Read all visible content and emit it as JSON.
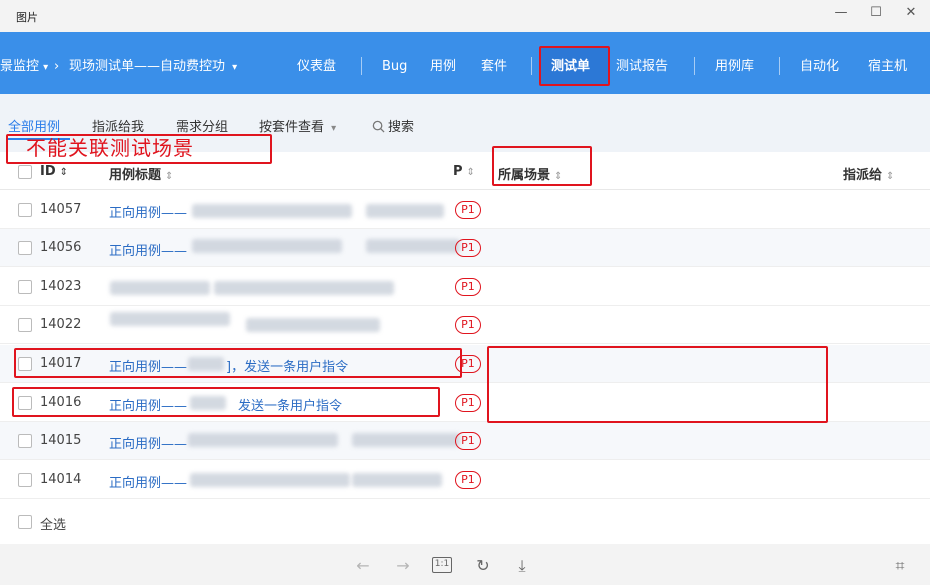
{
  "window": {
    "title": "图片",
    "minimize": "—",
    "maximize": "☐",
    "close": "✕"
  },
  "nav": {
    "project": "景监控",
    "project_caret": "▾",
    "breadcrumb_sep": "›",
    "testplan": "现场测试单——自动费控功",
    "testplan_caret": "▾",
    "items": [
      "仪表盘",
      "Bug",
      "用例",
      "套件",
      "测试单",
      "测试报告",
      "用例库",
      "自动化",
      "宿主机"
    ]
  },
  "toolbar": {
    "tabs": [
      "全部用例",
      "指派给我",
      "需求分组",
      "按套件查看"
    ],
    "suite_caret": "▾",
    "search_label": "搜索"
  },
  "annotation": {
    "text": "不能关联测试场景"
  },
  "table": {
    "headers": {
      "id": "ID",
      "title": "用例标题",
      "priority": "P",
      "scene": "所属场景",
      "assigned": "指派给"
    },
    "sort_icon": "⇕",
    "rows": [
      {
        "id": "14057",
        "title": "正向用例——",
        "priority": "P1"
      },
      {
        "id": "14056",
        "title": "正向用例——",
        "priority": "P1"
      },
      {
        "id": "14023",
        "title": "",
        "priority": "P1"
      },
      {
        "id": "14022",
        "title": "",
        "priority": "P1"
      },
      {
        "id": "14017",
        "title": "正向用例——",
        "title_tail": "]，发送一条用户指令",
        "priority": "P1"
      },
      {
        "id": "14016",
        "title": "正向用例——",
        "title_tail": "发送一条用户指令",
        "priority": "P1"
      },
      {
        "id": "14015",
        "title": "正向用例——",
        "priority": "P1"
      },
      {
        "id": "14014",
        "title": "正向用例——",
        "priority": "P1"
      }
    ],
    "select_all": "全选"
  },
  "viewer_toolbar": {
    "prev": "←",
    "next": "→",
    "actual_size": "1:1",
    "rotate": "↻",
    "download": "⤓",
    "ocr": "⌗"
  },
  "colors": {
    "accent": "#3a8fe9",
    "annotation_red": "#e0141e",
    "link": "#2b6cc4"
  }
}
